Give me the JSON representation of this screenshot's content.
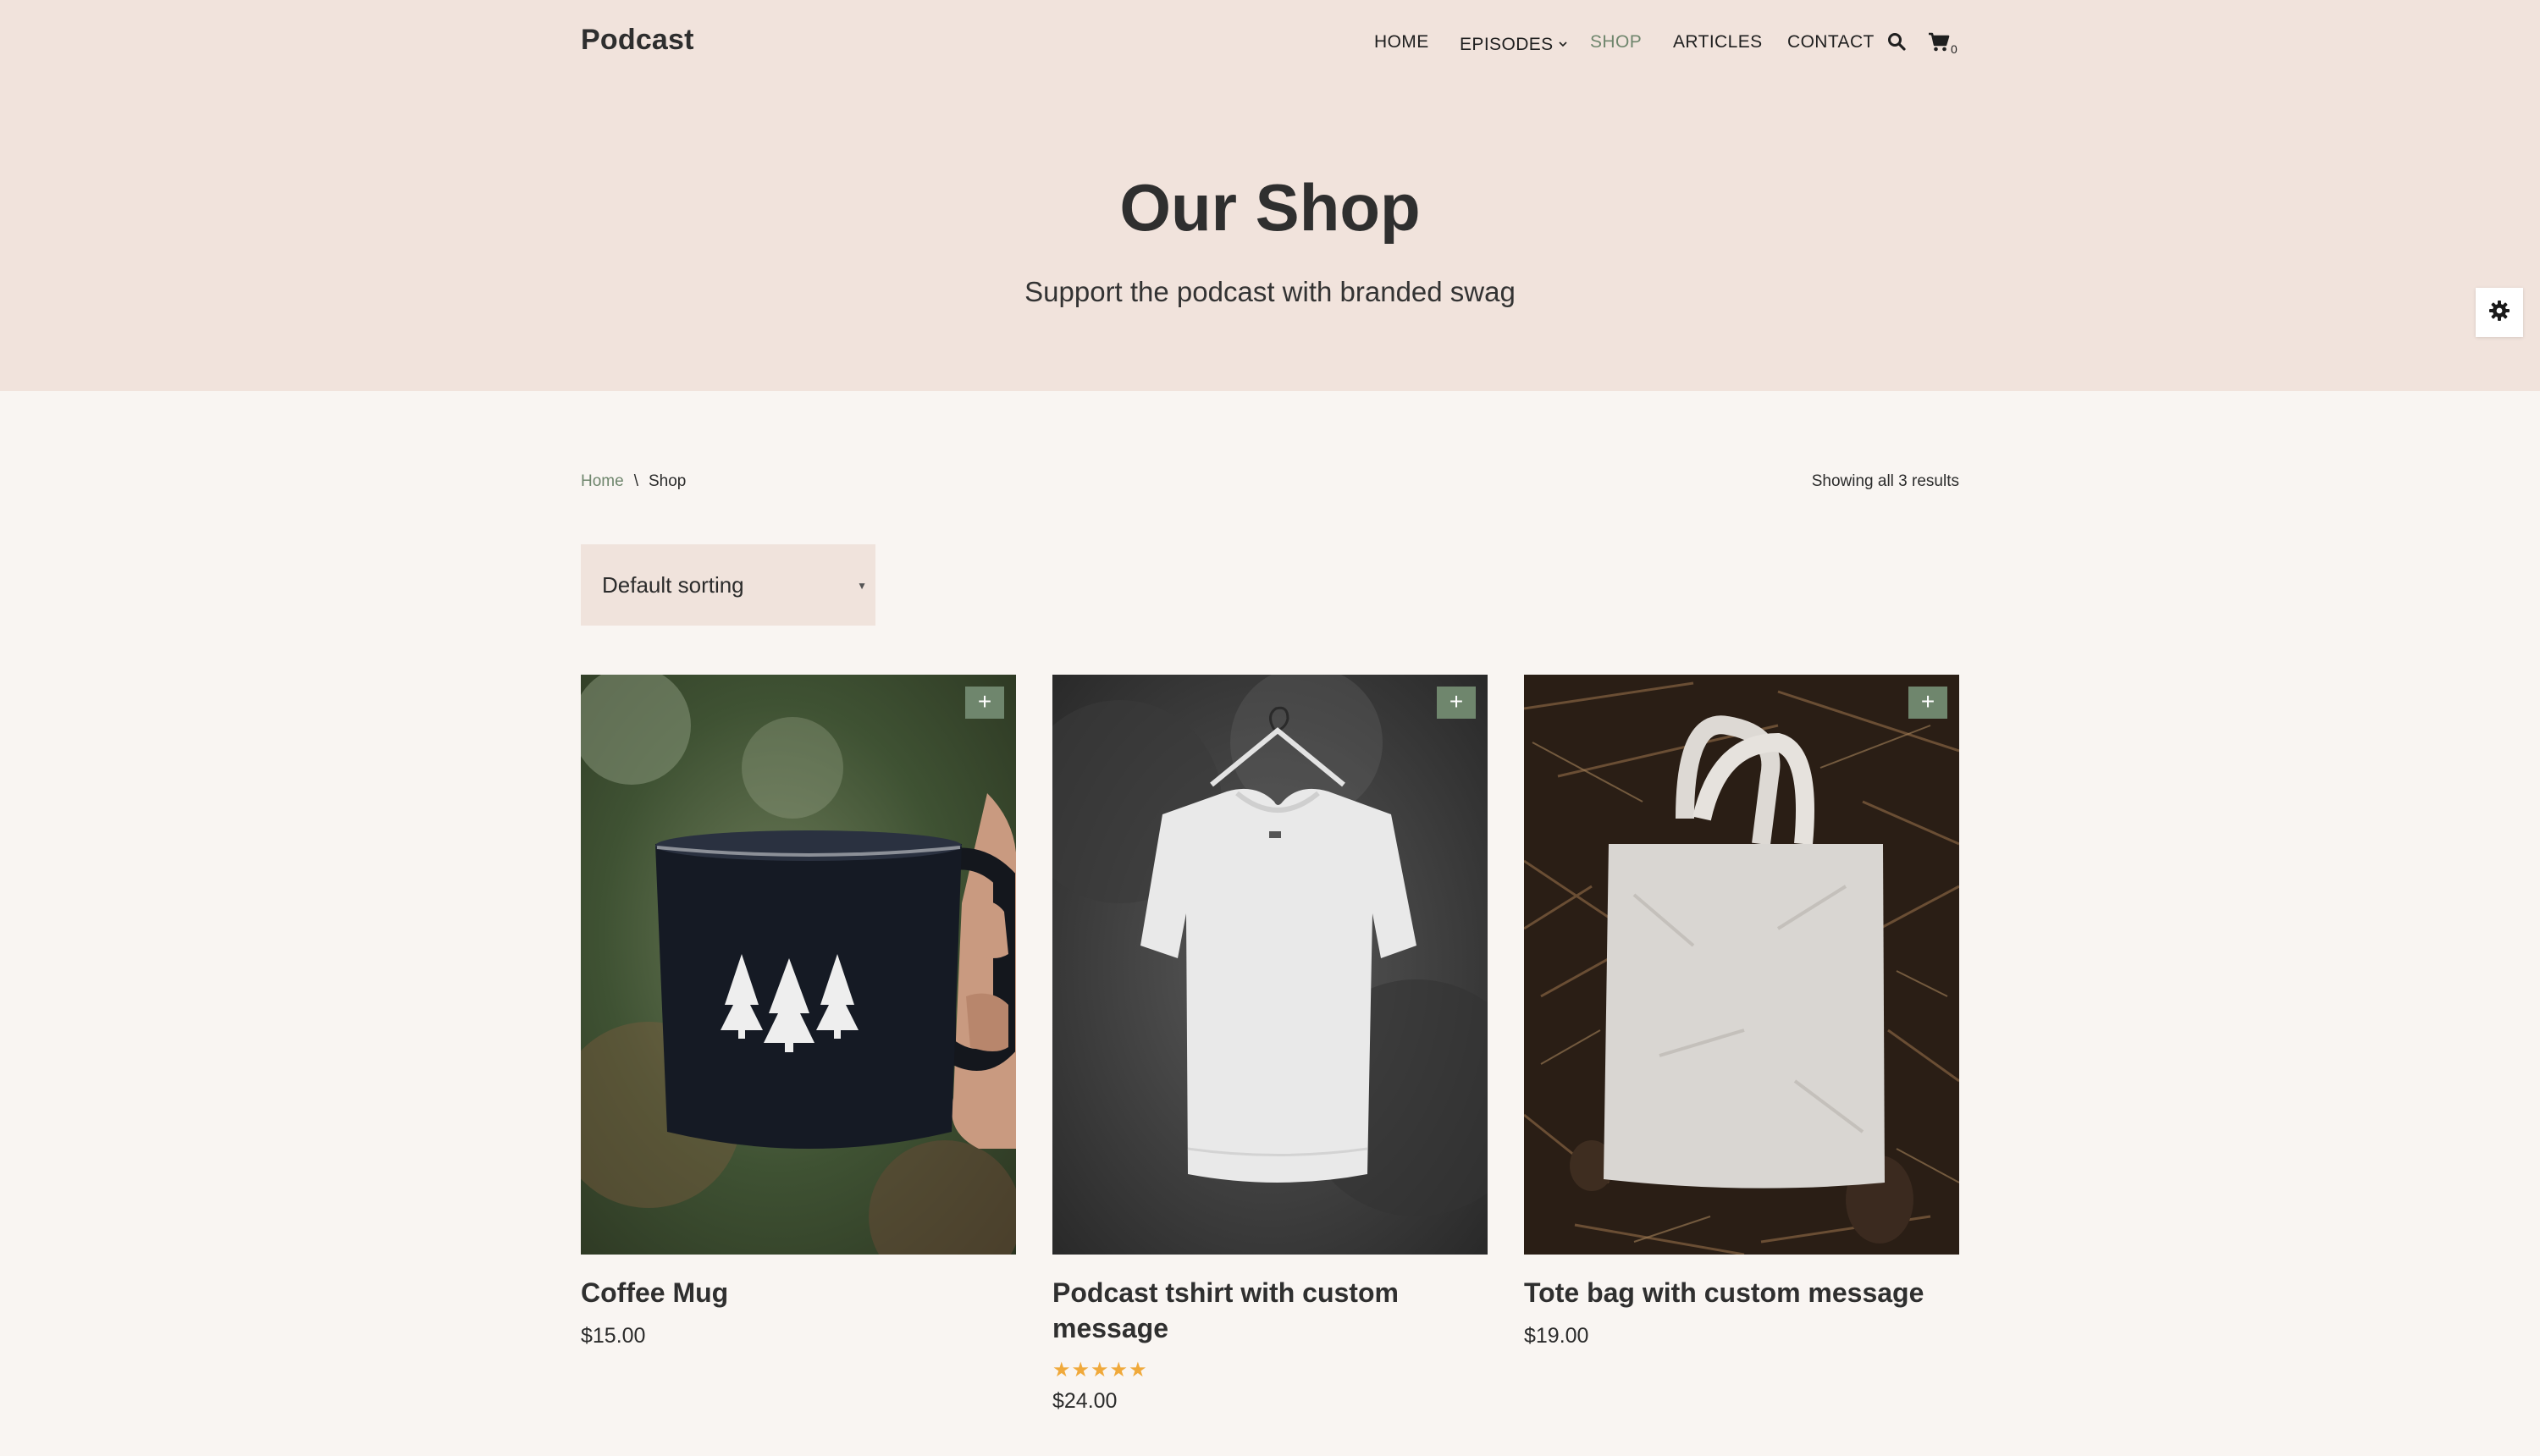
{
  "header": {
    "logo": "Podcast",
    "nav": [
      {
        "label": "HOME"
      },
      {
        "label": "EPISODES"
      },
      {
        "label": "SHOP"
      },
      {
        "label": "ARTICLES"
      },
      {
        "label": "CONTACT"
      }
    ],
    "cart_count": "0"
  },
  "hero": {
    "title": "Our Shop",
    "subtitle": "Support the podcast with branded swag"
  },
  "breadcrumb": {
    "home": "Home",
    "separator": "\\",
    "current": "Shop"
  },
  "results_text": "Showing all 3 results",
  "sorting": {
    "selected": "Default sorting"
  },
  "products": [
    {
      "title": "Coffee Mug",
      "price": "$15.00"
    },
    {
      "title": "Podcast tshirt with custom message",
      "price": "$24.00",
      "rating": 5,
      "rating_max": 5
    },
    {
      "title": "Tote bag with custom message",
      "price": "$19.00"
    }
  ],
  "colors": {
    "accent": "#6f866d",
    "hero_bg": "#f1e3dc",
    "page_bg": "#f9f5f2",
    "star": "#f0a93b"
  },
  "icons": {
    "search": "search-icon",
    "cart": "cart-icon",
    "settings": "gear-icon",
    "add": "plus-icon",
    "dropdown": "caret-down-icon"
  }
}
